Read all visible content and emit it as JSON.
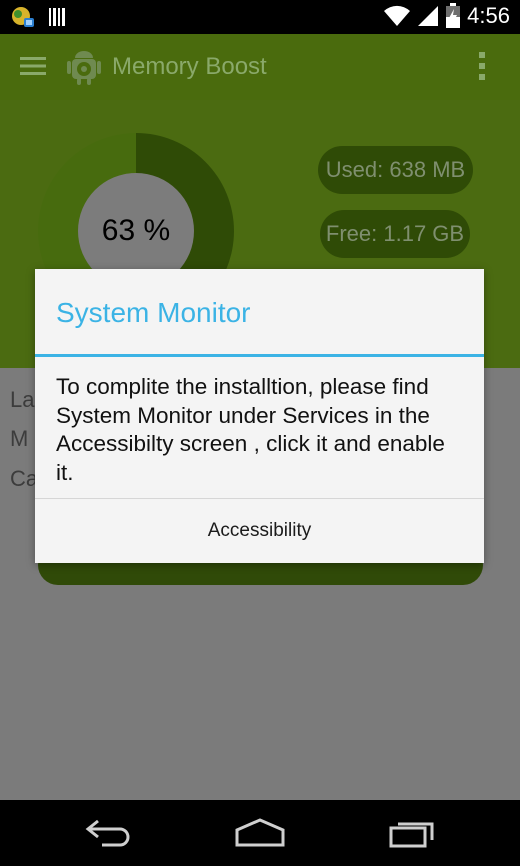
{
  "status_bar": {
    "time": "4:56",
    "icons": [
      "app-notification-icon",
      "barcode-icon",
      "wifi-icon",
      "signal-icon",
      "battery-icon"
    ]
  },
  "app_bar": {
    "title": "Memory Boost",
    "icons": [
      "menu-icon",
      "android-gear-icon",
      "overflow-icon"
    ]
  },
  "memory": {
    "percent_label": "63 %",
    "percent_value": 63,
    "used_label": "Used: 638 MB",
    "free_label": "Free: 1.17 GB"
  },
  "background_list": {
    "labels": [
      "La",
      "M",
      "Ca"
    ]
  },
  "dialog": {
    "title": "System Monitor",
    "body": "To complite the installtion, please find System Monitor under Services in the Accessibilty screen , click it and enable it.",
    "button_label": "Accessibility"
  },
  "colors": {
    "accent_blue": "#3bb3e5",
    "header_green": "#4b6b11",
    "ring_dark": "#2f4b06"
  },
  "nav_bar": {
    "icons": [
      "back-icon",
      "home-icon",
      "recents-icon"
    ]
  }
}
